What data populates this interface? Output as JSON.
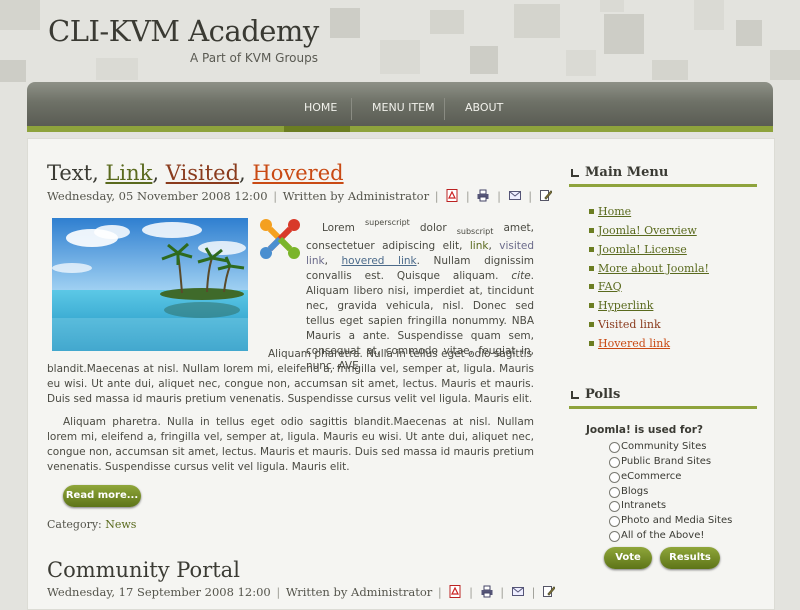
{
  "site": {
    "title": "CLI-KVM Academy",
    "tagline": "A Part of KVM Groups"
  },
  "nav": {
    "items": [
      "HOME",
      "MENU ITEM",
      "ABOUT"
    ],
    "active": "HOME",
    "accent": "#8ea33c"
  },
  "article1": {
    "title_plain": "Text, ",
    "title_link": "Link",
    "title_comma1": ", ",
    "title_visited": "Visited",
    "title_comma2": ", ",
    "title_hovered": "Hovered",
    "meta_date": "Wednesday, 05 November 2008 12:00",
    "meta_sep": "|",
    "meta_author": "Written by Administrator",
    "p1_lorem": "Lorem",
    "p1_sup": "superscript",
    "p1_dolor": "dolor",
    "p1_sub": "subscript",
    "p1_amet": "amet, consectetuer adipiscing elit,",
    "p1_link": "link",
    "p1_comma": ",",
    "p1_visited": "visited link",
    "p1_comma2": ",",
    "p1_hovered": "hovered link",
    "p1_rest1": ". Nullam dignissim convallis est. Quisque aliquam.",
    "p1_cite": "cite",
    "p1_rest2": ". Aliquam libero nisi, imperdiet at, tincidunt nec, gravida vehicula, nisl. Donec sed tellus eget sapien fringilla nonummy. NBA Mauris a ante. Suspendisse quam sem, consequat at, commodo vitae, feugiat in, nunc. AVE",
    "p2_start": "Aliquam pharetra. Nulla in tellus eget odio sagittis",
    "p2_rest": "blandit.Maecenas at nisl. Nullam lorem mi, eleifend a, fringilla vel, semper at, ligula. Mauris eu wisi. Ut ante dui, aliquet nec, congue non, accumsan sit amet, lectus. Mauris et mauris. Duis sed massa id mauris pretium venenatis. Suspendisse cursus velit vel ligula. Mauris elit.",
    "p3": "Aliquam pharetra. Nulla in tellus eget odio sagittis blandit.Maecenas at nisl. Nullam lorem mi, eleifend a, fringilla vel, semper at, ligula. Mauris eu wisi. Ut ante dui, aliquet nec, congue non, accumsan sit amet, lectus. Mauris et mauris. Duis sed massa id mauris pretium venenatis. Suspendisse cursus velit vel ligula. Mauris elit.",
    "readmore": "Read more...",
    "category_label": "Category:",
    "category_value": "News"
  },
  "article2": {
    "title": "Community Portal",
    "meta_date": "Wednesday, 17 September 2008 12:00",
    "meta_sep": "|",
    "meta_author": "Written by Administrator"
  },
  "sidebar": {
    "main_menu_title": "Main Menu",
    "menu_items": [
      "Home",
      "Joomla! Overview",
      "Joomla! License",
      "More about Joomla!",
      "FAQ",
      "Hyperlink",
      "Visited link",
      "Hovered link"
    ],
    "polls_title": "Polls",
    "poll_question": "Joomla! is used for?",
    "poll_options": [
      "Community Sites",
      "Public Brand Sites",
      "eCommerce",
      "Blogs",
      "Intranets",
      "Photo and Media Sites",
      "All of the Above!"
    ],
    "vote_label": "Vote",
    "results_label": "Results"
  }
}
